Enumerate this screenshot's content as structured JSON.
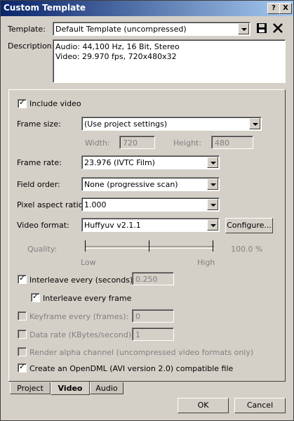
{
  "window": {
    "title": "Custom Template",
    "help_label": "?",
    "close_label": "X"
  },
  "template": {
    "label": "Template:",
    "value": "Default Template (uncompressed)",
    "save_icon": "floppy-disk-icon",
    "delete_icon": "x-delete-icon"
  },
  "description": {
    "label": "Description:",
    "line1": "Audio: 44,100 Hz, 16 Bit, Stereo",
    "line2": "Video: 29.970 fps, 720x480x32"
  },
  "video": {
    "include_video_label": "Include video",
    "include_video_checked": true,
    "frame_size_label": "Frame size:",
    "frame_size_value": "(Use project settings)",
    "width_label": "Width:",
    "width_value": "720",
    "height_label": "Height:",
    "height_value": "480",
    "frame_rate_label": "Frame rate:",
    "frame_rate_value": "23.976 (IVTC Film)",
    "field_order_label": "Field order:",
    "field_order_value": "None (progressive scan)",
    "pixel_aspect_label": "Pixel aspect ratio:",
    "pixel_aspect_value": "1.000",
    "video_format_label": "Video format:",
    "video_format_value": "Huffyuv v2.1.1",
    "configure_label": "Configure...",
    "quality_label": "Quality:",
    "quality_value": "100.0 %",
    "quality_low": "Low",
    "quality_high": "High",
    "interleave_label": "Interleave every (seconds):",
    "interleave_checked": true,
    "interleave_value": "0.250",
    "interleave_frame_label": "Interleave every frame",
    "interleave_frame_checked": true,
    "keyframe_label": "Keyframe every (frames):",
    "keyframe_value": "0",
    "datarate_label": "Data rate (KBytes/second):",
    "datarate_value": "1",
    "render_alpha_label": "Render alpha channel (uncompressed video formats only)",
    "opendml_label": "Create an OpenDML (AVI version 2.0) compatible file",
    "opendml_checked": true
  },
  "tabs": [
    "Project",
    "Video",
    "Audio"
  ],
  "buttons": {
    "ok": "OK",
    "cancel": "Cancel"
  },
  "colors": {
    "title_start": "#0a246a",
    "title_end": "#a6caf0",
    "face": "#d4d0c8"
  }
}
